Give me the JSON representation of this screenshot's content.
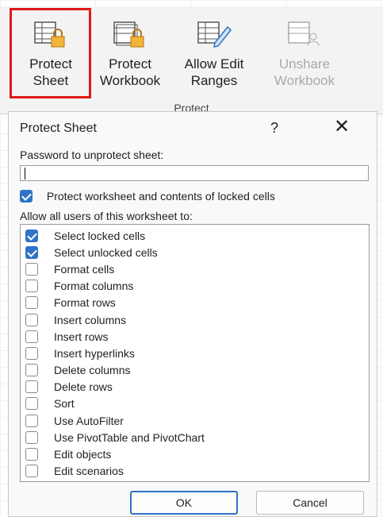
{
  "ribbon": {
    "buttons": [
      {
        "label": "Protect\nSheet",
        "icon": "protect-sheet-icon",
        "enabled": true
      },
      {
        "label": "Protect\nWorkbook",
        "icon": "protect-workbook-icon",
        "enabled": true
      },
      {
        "label": "Allow Edit\nRanges",
        "icon": "allow-edit-ranges-icon",
        "enabled": true
      },
      {
        "label": "Unshare\nWorkbook",
        "icon": "unshare-workbook-icon",
        "enabled": false
      }
    ],
    "group_label": "Protect",
    "highlight_color": "#e01818"
  },
  "dialog": {
    "title": "Protect Sheet",
    "help": "?",
    "close": "✕",
    "password_label": "Password to unprotect sheet:",
    "password_value": "",
    "protect_label": "Protect worksheet and contents of locked cells",
    "protect_checked": true,
    "allow_label": "Allow all users of this worksheet to:",
    "permissions": [
      {
        "label": "Select locked cells",
        "checked": true
      },
      {
        "label": "Select unlocked cells",
        "checked": true
      },
      {
        "label": "Format cells",
        "checked": false
      },
      {
        "label": "Format columns",
        "checked": false
      },
      {
        "label": "Format rows",
        "checked": false
      },
      {
        "label": "Insert columns",
        "checked": false
      },
      {
        "label": "Insert rows",
        "checked": false
      },
      {
        "label": "Insert hyperlinks",
        "checked": false
      },
      {
        "label": "Delete columns",
        "checked": false
      },
      {
        "label": "Delete rows",
        "checked": false
      },
      {
        "label": "Sort",
        "checked": false
      },
      {
        "label": "Use AutoFilter",
        "checked": false
      },
      {
        "label": "Use PivotTable and PivotChart",
        "checked": false
      },
      {
        "label": "Edit objects",
        "checked": false
      },
      {
        "label": "Edit scenarios",
        "checked": false
      }
    ],
    "ok_label": "OK",
    "cancel_label": "Cancel",
    "accent_color": "#2f74c6"
  }
}
